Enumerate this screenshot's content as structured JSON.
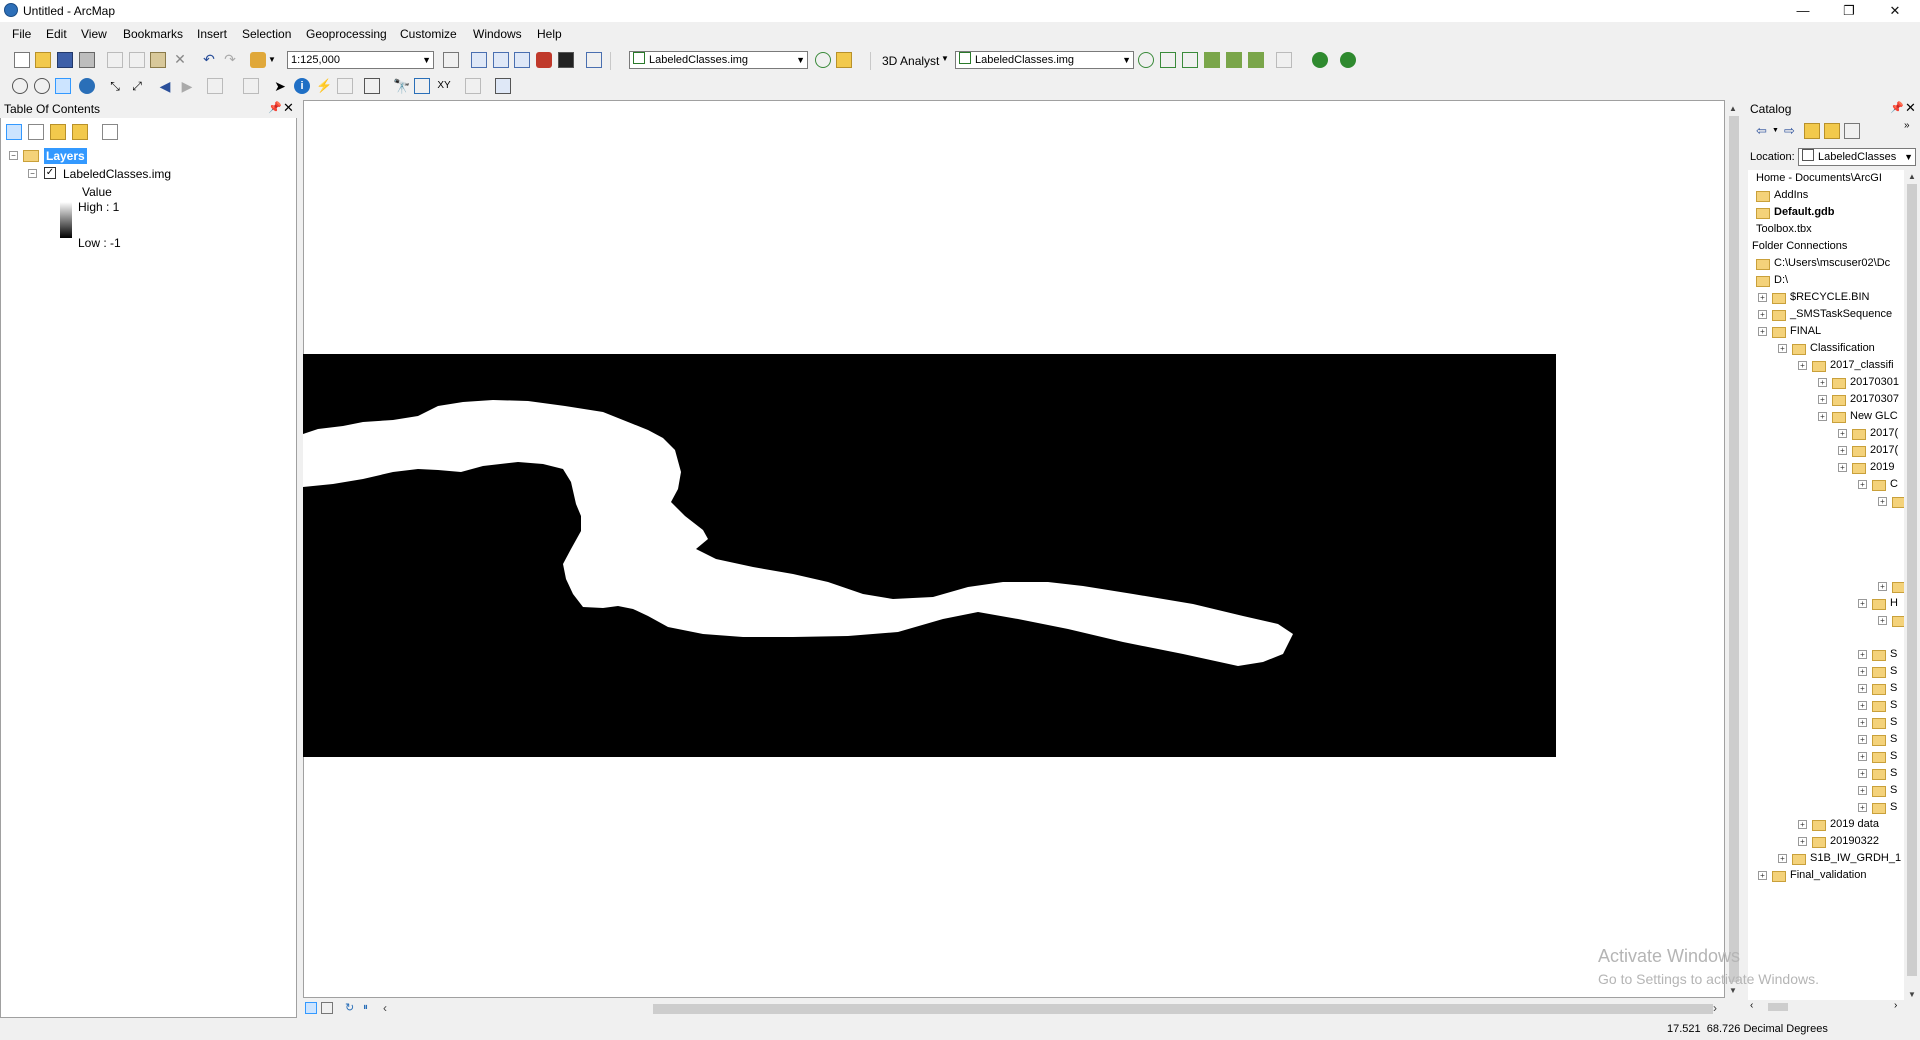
{
  "window": {
    "title": "Untitled - ArcMap",
    "controls": {
      "minimize": "—",
      "restore": "❐",
      "close": "✕"
    }
  },
  "menu": [
    "File",
    "Edit",
    "View",
    "Bookmarks",
    "Insert",
    "Selection",
    "Geoprocessing",
    "Customize",
    "Windows",
    "Help"
  ],
  "toolbar": {
    "scale_value": "1:125,000",
    "layer_combo_1": "LabeledClasses.img",
    "analyst_label": "3D Analyst",
    "layer_combo_2": "LabeledClasses.img"
  },
  "toc": {
    "title": "Table Of Contents",
    "root_label": "Layers",
    "layer_name": "LabeledClasses.img",
    "legend_value_label": "Value",
    "legend_high": "High : 1",
    "legend_low": "Low : -1"
  },
  "catalog": {
    "title": "Catalog",
    "location_label": "Location:",
    "location_value": "LabeledClasses",
    "items": [
      {
        "label": "Home - Documents\\ArcGI",
        "bold": false,
        "folder": false
      },
      {
        "label": "AddIns",
        "bold": false,
        "folder": true
      },
      {
        "label": "Default.gdb",
        "bold": true,
        "folder": true
      },
      {
        "label": "Toolbox.tbx",
        "bold": false,
        "folder": false
      },
      {
        "label": "Folder Connections",
        "bold": false,
        "folder": false
      },
      {
        "label": "C:\\Users\\mscuser02\\Dc",
        "bold": false,
        "folder": true
      },
      {
        "label": "D:\\",
        "bold": false,
        "folder": true
      },
      {
        "label": "$RECYCLE.BIN",
        "bold": false,
        "folder": true
      },
      {
        "label": "_SMSTaskSequence",
        "bold": false,
        "folder": true
      },
      {
        "label": "FINAL",
        "bold": false,
        "folder": true
      },
      {
        "label": "Classification",
        "bold": false,
        "folder": true
      },
      {
        "label": "2017_classifi",
        "bold": false,
        "folder": true
      },
      {
        "label": "20170301",
        "bold": false,
        "folder": true
      },
      {
        "label": "20170307",
        "bold": false,
        "folder": true
      },
      {
        "label": "New GLC",
        "bold": false,
        "folder": true
      },
      {
        "label": "2017(",
        "bold": false,
        "folder": true
      },
      {
        "label": "2017(",
        "bold": false,
        "folder": true
      },
      {
        "label": "2019",
        "bold": false,
        "folder": true
      },
      {
        "label": "C",
        "bold": false,
        "folder": true
      },
      {
        "label": "",
        "bold": false,
        "folder": true
      },
      {
        "label": "",
        "bold": false,
        "folder": false
      },
      {
        "label": "",
        "bold": false,
        "folder": false
      },
      {
        "label": "",
        "bold": false,
        "folder": false
      },
      {
        "label": "",
        "bold": false,
        "folder": false
      },
      {
        "label": "",
        "bold": false,
        "folder": true
      },
      {
        "label": "H",
        "bold": false,
        "folder": true
      },
      {
        "label": "",
        "bold": false,
        "folder": true
      },
      {
        "label": "",
        "bold": false,
        "folder": false
      },
      {
        "label": "S",
        "bold": false,
        "folder": true
      },
      {
        "label": "S",
        "bold": false,
        "folder": true
      },
      {
        "label": "S",
        "bold": false,
        "folder": true
      },
      {
        "label": "S",
        "bold": false,
        "folder": true
      },
      {
        "label": "S",
        "bold": false,
        "folder": true
      },
      {
        "label": "S",
        "bold": false,
        "folder": true
      },
      {
        "label": "S",
        "bold": false,
        "folder": true
      },
      {
        "label": "S",
        "bold": false,
        "folder": true
      },
      {
        "label": "S",
        "bold": false,
        "folder": true
      },
      {
        "label": "S",
        "bold": false,
        "folder": true
      },
      {
        "label": "2019 data",
        "bold": false,
        "folder": true
      },
      {
        "label": "20190322",
        "bold": false,
        "folder": true
      },
      {
        "label": "S1B_IW_GRDH_1",
        "bold": false,
        "folder": true
      },
      {
        "label": "Final_validation",
        "bold": false,
        "folder": true
      }
    ]
  },
  "watermark": {
    "line1": "Activate Windows",
    "line2": "Go to Settings to activate Windows."
  },
  "status": {
    "coordinates": "17.521  68.726 Decimal Degrees"
  },
  "colors": {
    "raster_background": "#000000",
    "raster_class": "#ffffff",
    "selection": "#3399ff"
  }
}
